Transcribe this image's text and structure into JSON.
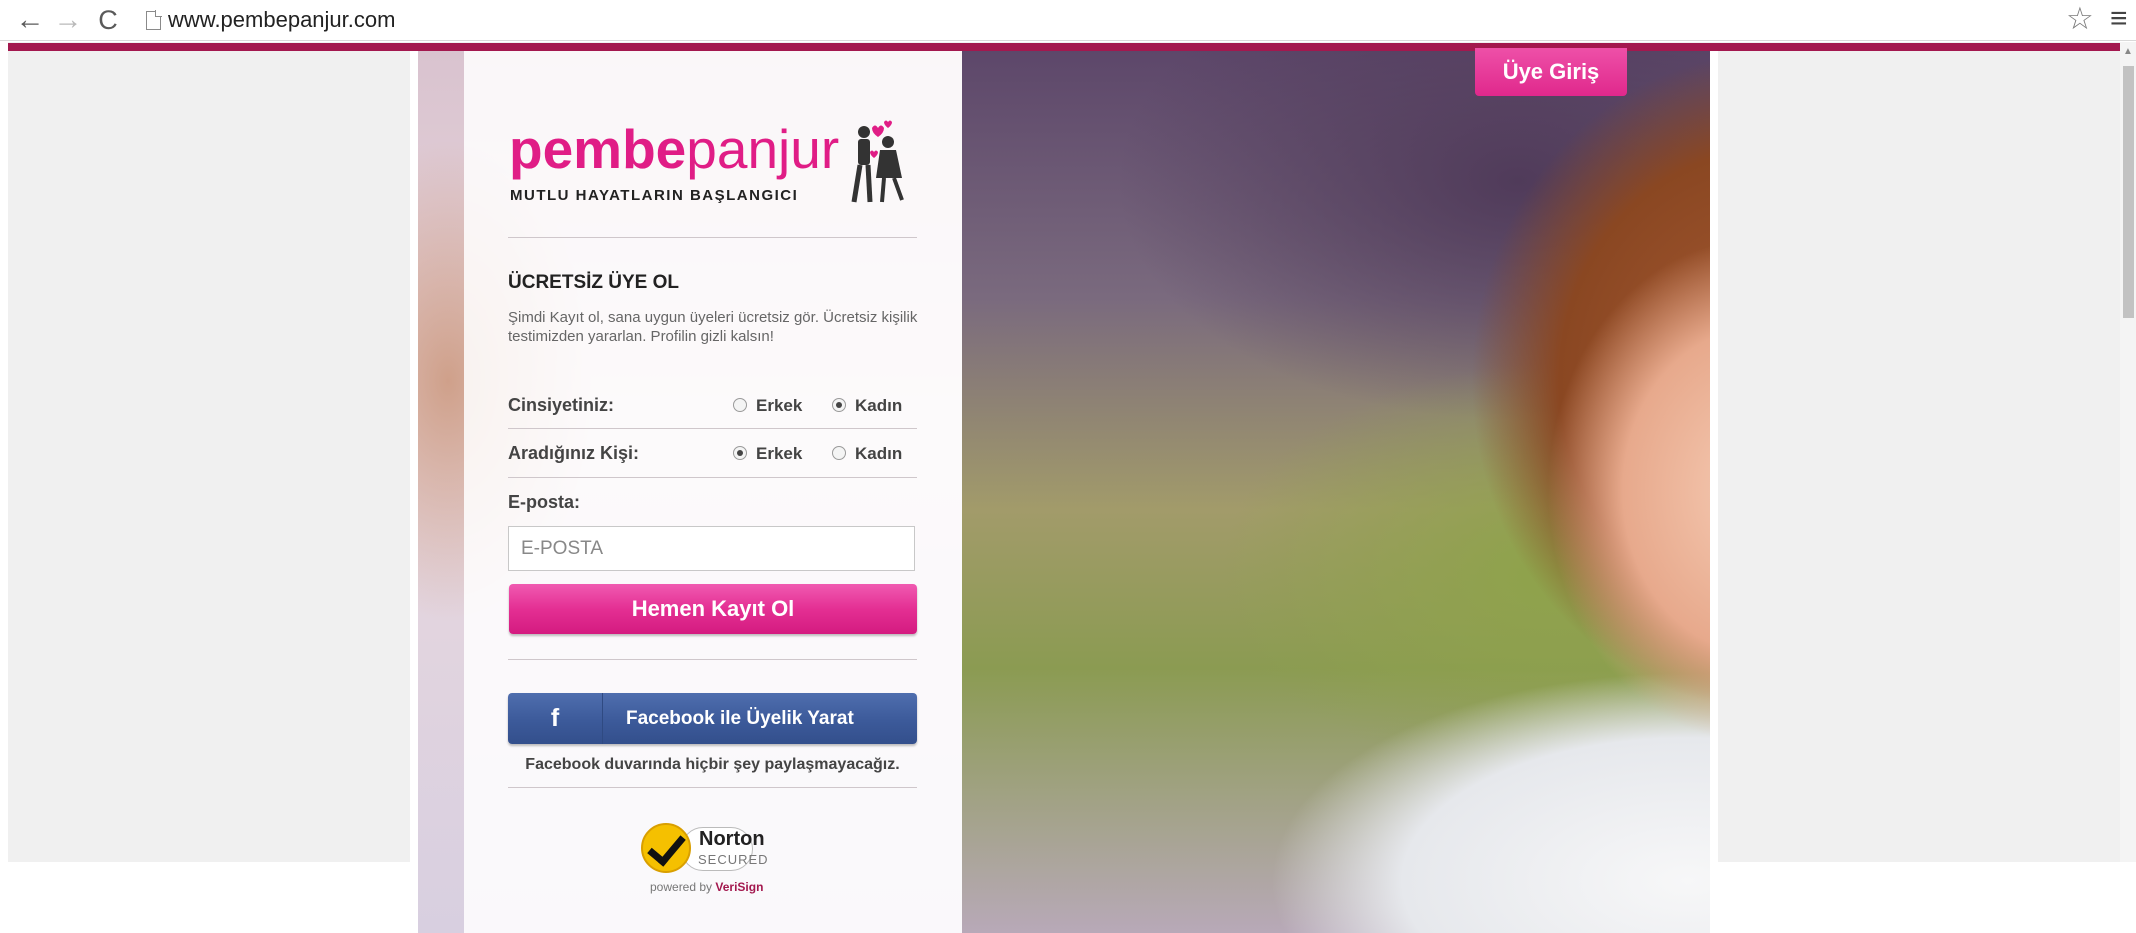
{
  "browser": {
    "url": "www.pembepanjur.com",
    "back_icon": "←",
    "forward_icon": "→",
    "reload_icon": "C",
    "star_icon": "☆",
    "menu_icon": "≡"
  },
  "header": {
    "login_label": "Üye Giriş"
  },
  "logo": {
    "bold": "pembe",
    "light": "panjur",
    "tagline": "MUTLU HAYATLARIN BAŞLANGICI"
  },
  "signup": {
    "title": "ÜCRETSİZ ÜYE OL",
    "description": "Şimdi Kayıt ol, sana uygun üyeleri ücretsiz gör. Ücretsiz kişilik testimizden yararlan. Profilin gizli kalsın!",
    "gender_label": "Cinsiyetiniz:",
    "seeking_label": "Aradığınız Kişi:",
    "male": "Erkek",
    "female": "Kadın",
    "gender_selected": "Kadın",
    "seeking_selected": "Erkek",
    "email_label": "E-posta:",
    "email_placeholder": "E-POSTA",
    "email_value": "",
    "register_button": "Hemen Kayıt Ol"
  },
  "facebook": {
    "icon": "f",
    "button": "Facebook ile Üyelik Yarat",
    "note": "Facebook duvarında hiçbir şey paylaşmayacağız."
  },
  "badge": {
    "name": "Norton",
    "secured": "SECURED",
    "powered_prefix": "powered by",
    "powered_brand": "VeriSign"
  },
  "colors": {
    "brand_pink": "#e01d86",
    "top_bar": "#a3184e",
    "facebook_blue": "#3c5a9a"
  }
}
